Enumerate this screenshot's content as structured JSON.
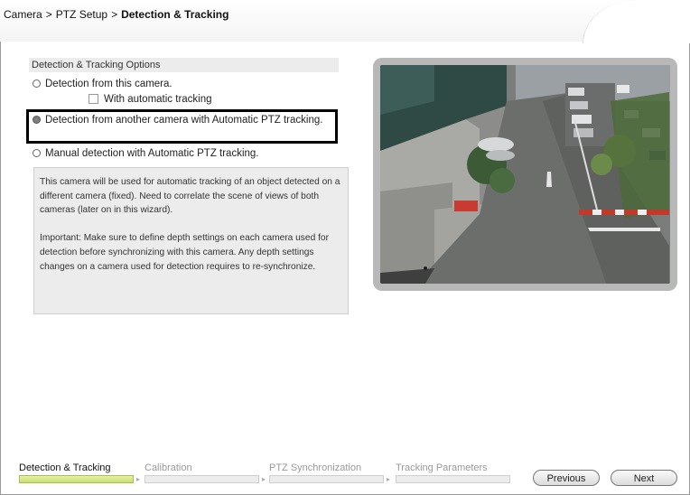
{
  "breadcrumb": {
    "items": [
      "Camera",
      "PTZ Setup",
      "Detection & Tracking"
    ],
    "separator": ">"
  },
  "options": {
    "title": "Detection & Tracking Options",
    "radio_this_camera": "Detection from this camera.",
    "checkbox_auto_tracking": "With automatic tracking",
    "radio_another_camera": "Detection from another camera with Automatic PTZ tracking.",
    "radio_manual": "Manual detection with Automatic PTZ tracking.",
    "selected": "radio_another_camera"
  },
  "description": {
    "paragraph1": "This camera will be used for automatic tracking of an object detected on a different camera (fixed). Need to correlate the scene of views of both cameras (later on in this wizard).",
    "paragraph2": "Important: Make sure to define depth settings on each camera used for detection before synchronizing with this camera. Any depth settings changes on a camera used for detection requires to re-synchronize."
  },
  "wizard": {
    "steps": [
      "Detection & Tracking",
      "Calibration",
      "PTZ Synchronization",
      "Tracking Parameters"
    ],
    "active_index": 0,
    "previous_label": "Previous",
    "next_label": "Next"
  },
  "colors": {
    "active_step": "#c9df6f",
    "highlight_border": "#000000",
    "panel_gray": "#ececec"
  }
}
